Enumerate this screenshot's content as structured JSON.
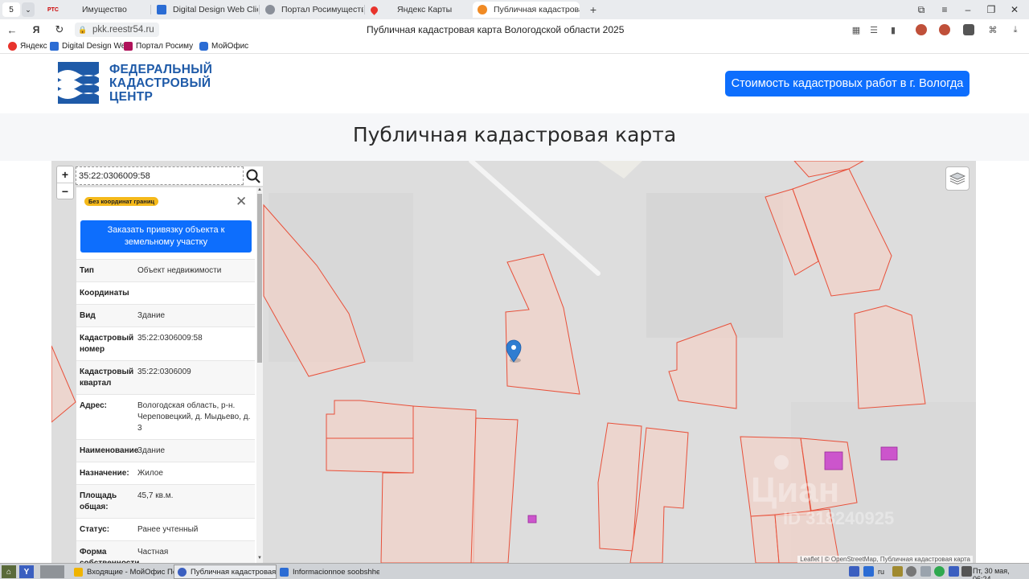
{
  "browser": {
    "tab_counter": "5",
    "tabs": [
      {
        "title": "Имущество",
        "fav_text": "РТС",
        "fav_color": "#ffffff"
      },
      {
        "title": "Digital Design Web Client",
        "fav_color": "#2b6cd4"
      },
      {
        "title": "Портал Росимущества",
        "fav_color": "#8a8f99"
      },
      {
        "title": "Яндекс Карты",
        "fav_color": "#e8332c"
      },
      {
        "title": "Публичная кадастровая",
        "fav_color": "#f08a24"
      }
    ],
    "url": "pkk.reestr54.ru",
    "page_title": "Публичная кадастровая карта Вологодской области 2025",
    "bookmarks": [
      {
        "label": "Яндекс",
        "color": "#e8332c"
      },
      {
        "label": "Digital Design We",
        "color": "#2b6cd4"
      },
      {
        "label": "Портал Росиму",
        "color": "#b0125a"
      },
      {
        "label": "МойОфис",
        "color": "#2b6cd4"
      }
    ]
  },
  "site": {
    "logo_lines": [
      "ФЕДЕРАЛЬНЫЙ",
      "КАДАСТРОВЫЙ",
      "ЦЕНТР"
    ],
    "cost_button": "Стоимость кадастровых работ в г. Вологда",
    "heading": "Публичная кадастровая карта",
    "accent": "#0d6efd",
    "brand": "#1e5aa8"
  },
  "map": {
    "zoom_in": "+",
    "zoom_out": "−",
    "search_value": "35:22:0306009:58",
    "attribution": "Leaflet | © OpenStreetMap, Публичная кадастровая карта",
    "parcel_fill": "#f0d2c8",
    "parcel_stroke": "#e8503a",
    "building_fill": "#cc55cc"
  },
  "panel": {
    "badge": "Без координат границ",
    "order_button": "Заказать привязку объекта к земельному участку",
    "props": [
      {
        "key": "Тип",
        "value": "Объект недвижимости"
      },
      {
        "key": "Координаты",
        "value": ""
      },
      {
        "key": "Вид",
        "value": "Здание"
      },
      {
        "key": "Кадастровый номер",
        "value": "35:22:0306009:58"
      },
      {
        "key": "Кадастровый квартал",
        "value": "35:22:0306009"
      },
      {
        "key": "Адрес:",
        "value": "Вологодская область, р-н. Череповецкий, д. Мыдьево, д. 3"
      },
      {
        "key": "Наименование",
        "value": "Здание"
      },
      {
        "key": "Назначение:",
        "value": "Жилое"
      },
      {
        "key": "Площадь общая:",
        "value": "45,7 кв.м."
      },
      {
        "key": "Статус:",
        "value": "Ранее учтенный"
      },
      {
        "key": "Форма собственности",
        "value": "Частная"
      }
    ]
  },
  "taskbar": {
    "tasks": [
      {
        "label": "Входящие - МойОфис По...",
        "color": "#f0b400"
      },
      {
        "label": "Публичная кадастровая ...",
        "color": "#3b5fc0"
      },
      {
        "label": "Informacionnoe soobshhe...",
        "color": "#2b6cd4"
      }
    ],
    "lang": "ru",
    "clock": "Пт, 30 мая, 06:24"
  }
}
